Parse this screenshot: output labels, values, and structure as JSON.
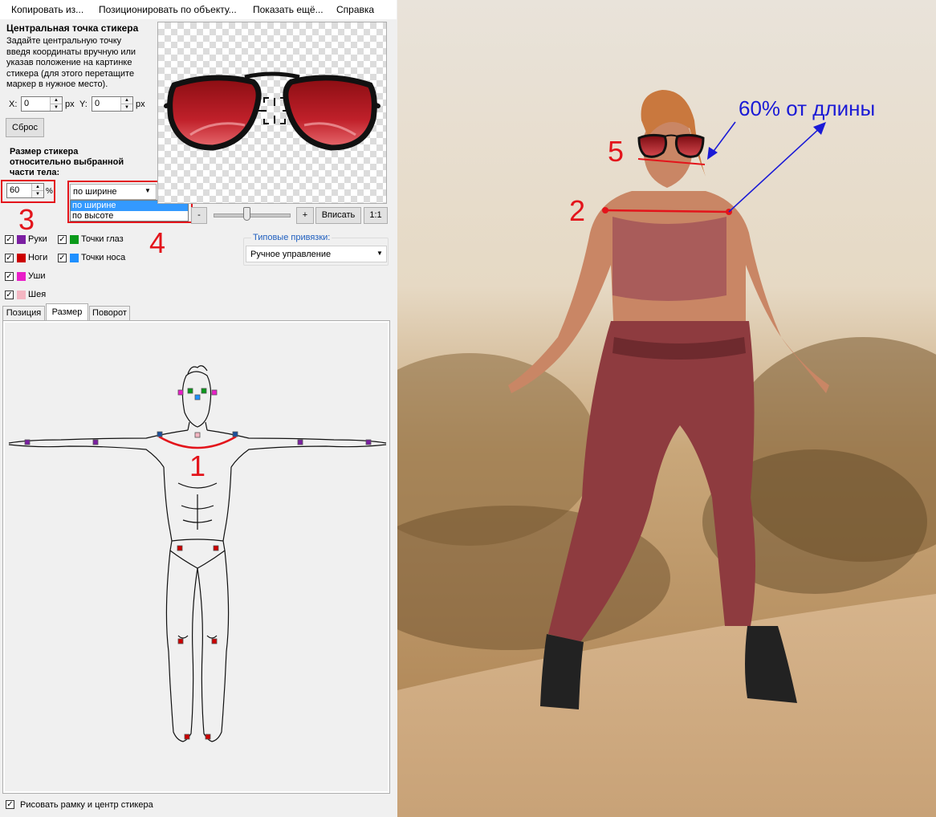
{
  "menu": {
    "copy_from": "Копировать из...",
    "position_by_object": "Позиционировать по объекту...",
    "show_more": "Показать ещё...",
    "help": "Справка"
  },
  "center_point": {
    "title": "Центральная точка стикера",
    "description_lines": [
      "Задайте центральную точку",
      "введя координаты вручную или",
      "указав положение на картинке",
      "стикера (для этого перетащите",
      "маркер в нужное место)."
    ],
    "x_label": "X:",
    "x_value": "0",
    "x_unit": "px",
    "y_label": "Y:",
    "y_value": "0",
    "y_unit": "px",
    "reset_label": "Сброс"
  },
  "size": {
    "title_lines": [
      "Размер стикера",
      "относительно выбранной",
      "части тела:"
    ],
    "percent_value": "60",
    "percent_unit": "%",
    "mode_selected": "по ширине",
    "mode_options": [
      "по ширине",
      "по высоте"
    ]
  },
  "zoom": {
    "minus": "-",
    "plus": "+",
    "fit": "Вписать",
    "one_to_one": "1:1",
    "slider_level": 0.45
  },
  "body_parts": [
    {
      "label": "Руки",
      "color": "#7b1fa2",
      "checked": true
    },
    {
      "label": "Ноги",
      "color": "#cc0000",
      "checked": true
    },
    {
      "label": "Уши",
      "color": "#e91ec8",
      "checked": true
    },
    {
      "label": "Шея",
      "color": "#f4b6c2",
      "checked": true
    },
    {
      "label": "Точки глаз",
      "color": "#0a9a1a",
      "checked": true
    },
    {
      "label": "Точки носа",
      "color": "#1e90ff",
      "checked": true
    }
  ],
  "presets": {
    "label": "Типовые привязки:",
    "selected": "Ручное управление"
  },
  "tabs": [
    "Позиция",
    "Размер",
    "Поворот"
  ],
  "active_tab": "Размер",
  "draw_frame": {
    "label": "Рисовать рамку и центр стикера",
    "checked": true
  },
  "annotations": {
    "n1": "1",
    "n2": "2",
    "n3": "3",
    "n4": "4",
    "n5": "5",
    "length_note": "60% от длины"
  },
  "colors": {
    "annotation_red": "#e3141b",
    "annotation_blue": "#1a1ad6",
    "selection_blue": "#3399ff"
  }
}
